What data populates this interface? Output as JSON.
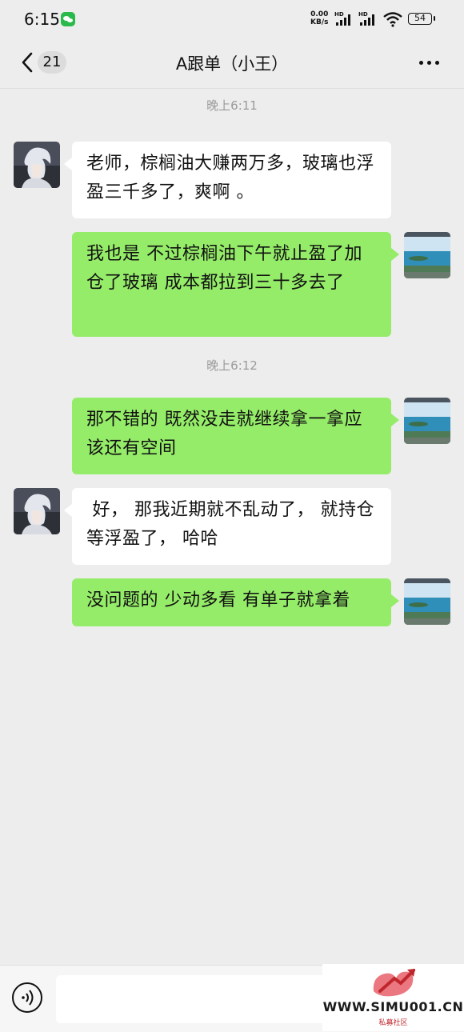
{
  "status_bar": {
    "time": "6:15",
    "net_speed_value": "0.00",
    "net_speed_unit": "KB/s",
    "signal_1_label": "HD",
    "signal_2_label": "HD",
    "battery": "54"
  },
  "header": {
    "unread_count": "21",
    "title": "A跟单（小王）"
  },
  "messages": [
    {
      "type": "time",
      "text": "晚上6:11"
    },
    {
      "type": "in",
      "text": "老师，棕榈油大赚两万多，玻璃也浮盈三千多了，爽啊 。"
    },
    {
      "type": "out",
      "text": "我也是 不过棕榈油下午就止盈了加仓了玻璃 成本都拉到三十多去了"
    },
    {
      "type": "time",
      "text": "晚上6:12"
    },
    {
      "type": "out",
      "text": "那不错的 既然没走就继续拿一拿应该还有空间"
    },
    {
      "type": "in",
      "text": " 好， 那我近期就不乱动了， 就持仓等浮盈了， 哈哈"
    },
    {
      "type": "out",
      "text": "没问题的 少动多看 有单子就拿着"
    }
  ],
  "input_bar": {
    "voice_icon": "voice-icon",
    "input_value": ""
  },
  "watermark": {
    "text": "WWW.SIMU001.CN",
    "sub": "私募社区"
  },
  "colors": {
    "outgoing_bubble": "#95ec69",
    "incoming_bubble": "#ffffff",
    "background": "#ededed",
    "watermark_red": "#c0272d"
  }
}
